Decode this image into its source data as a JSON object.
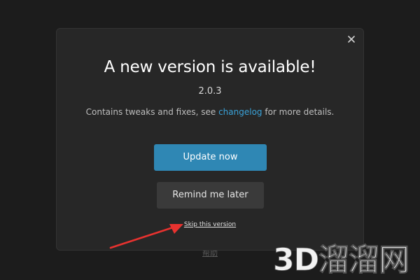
{
  "modal": {
    "title": "A new version is available!",
    "version": "2.0.3",
    "description_before": "Contains tweaks and fixes, see ",
    "changelog_link": "changelog",
    "description_after": " for more details.",
    "update_button": "Update now",
    "remind_button": "Remind me later",
    "skip_link": "Skip this version",
    "close_icon": "close-icon"
  },
  "background": {
    "help_link": "帮助"
  },
  "annotation": {
    "arrow_color": "#e8322f"
  },
  "watermark": {
    "text": "3D溜溜网"
  },
  "colors": {
    "primary": "#2f87b4",
    "link": "#3aa2d8",
    "modal_bg": "#272727",
    "page_bg": "#1c1c1c"
  }
}
